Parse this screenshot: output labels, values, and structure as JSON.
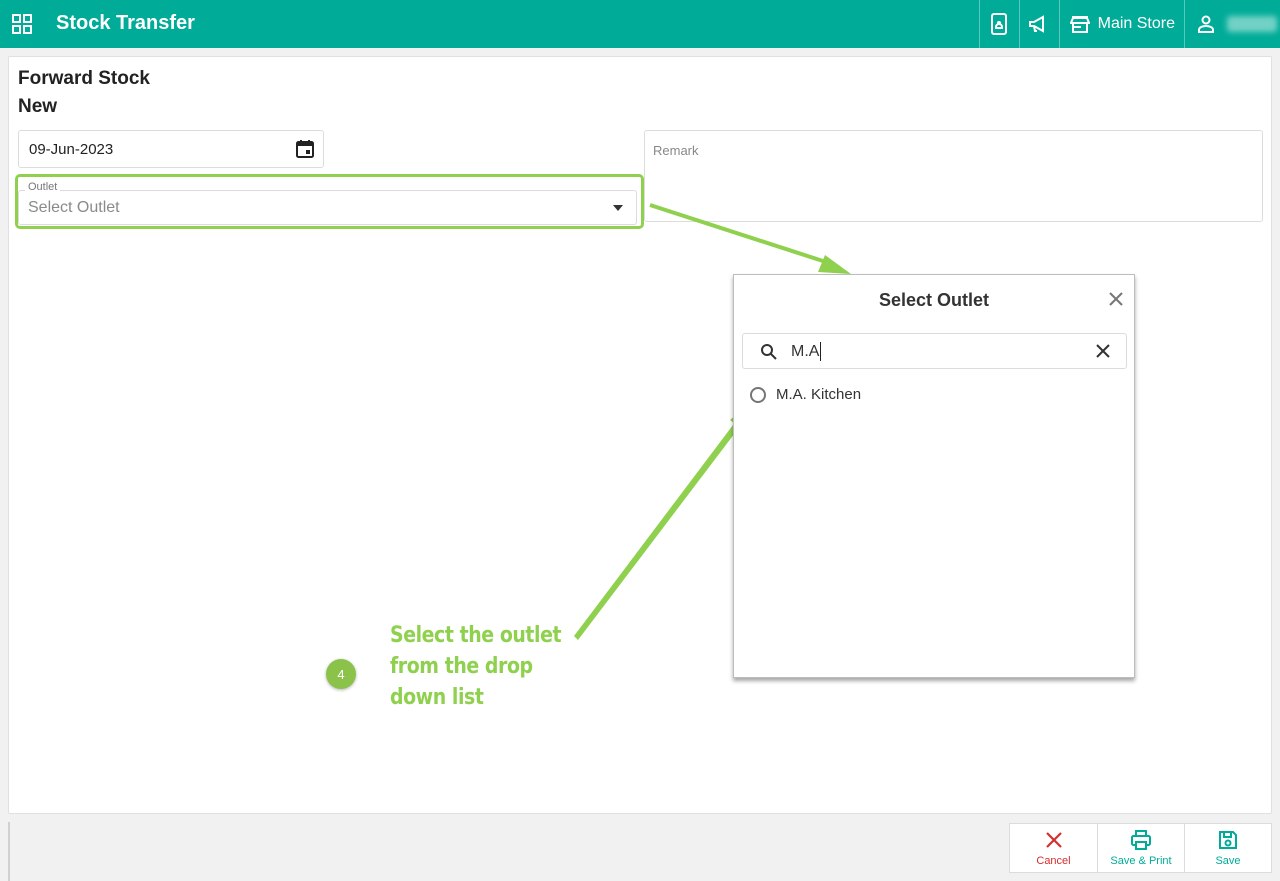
{
  "header": {
    "title": "Stock Transfer",
    "store_label": "Main Store"
  },
  "page": {
    "title": "Forward Stock",
    "subtitle": "New"
  },
  "form": {
    "date_value": "09-Jun-2023",
    "outlet_label": "Outlet",
    "outlet_placeholder": "Select Outlet",
    "remark_placeholder": "Remark"
  },
  "modal": {
    "title": "Select Outlet",
    "search_value": "M.A",
    "options": [
      {
        "label": "M.A. Kitchen"
      }
    ]
  },
  "annotation": {
    "step_number": "4",
    "lines": [
      "Select the outlet",
      "from the drop",
      "down list"
    ]
  },
  "actions": {
    "cancel_label": "Cancel",
    "save_print_label": "Save & Print",
    "save_label": "Save"
  },
  "colors": {
    "brand": "#00ac98",
    "highlight": "#8fd14f",
    "cancel": "#d32f2f"
  }
}
